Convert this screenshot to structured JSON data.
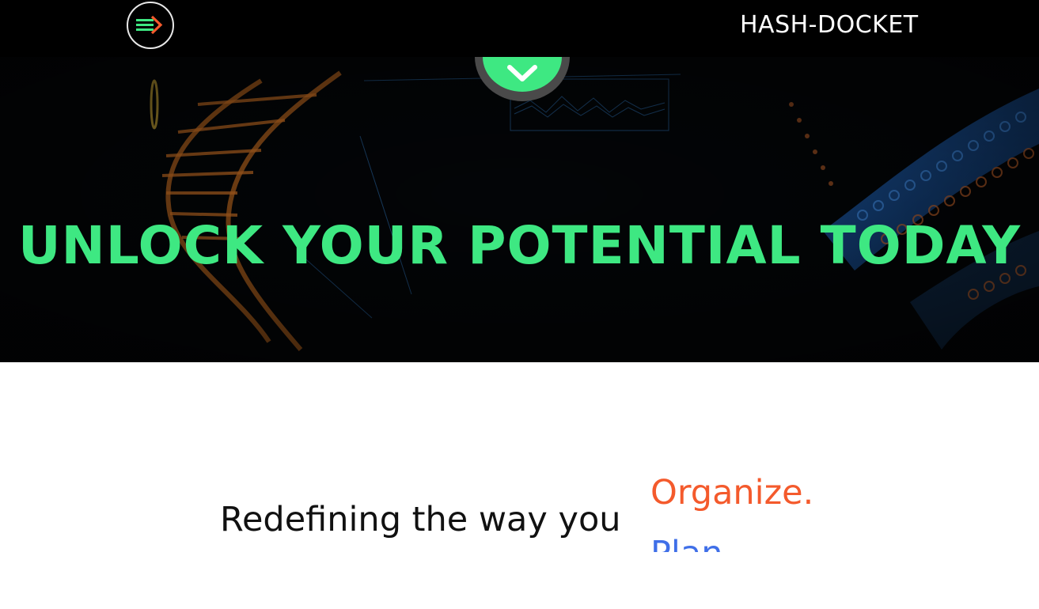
{
  "navbar": {
    "brand": "HASH-DOCKET",
    "logo_icon": "forward-arrow-icon"
  },
  "hero": {
    "title": "UNLOCK YOUR POTENTIAL TODAY",
    "scroll_icon": "chevron-down-icon"
  },
  "tagline": {
    "prefix": "Redefining the way you",
    "words": [
      "Organize.",
      "Plan."
    ]
  },
  "colors": {
    "accent_green": "#3ee882",
    "word_orange": "#f45a2c",
    "word_blue": "#3f6fe8",
    "nav_bg": "#000000"
  }
}
